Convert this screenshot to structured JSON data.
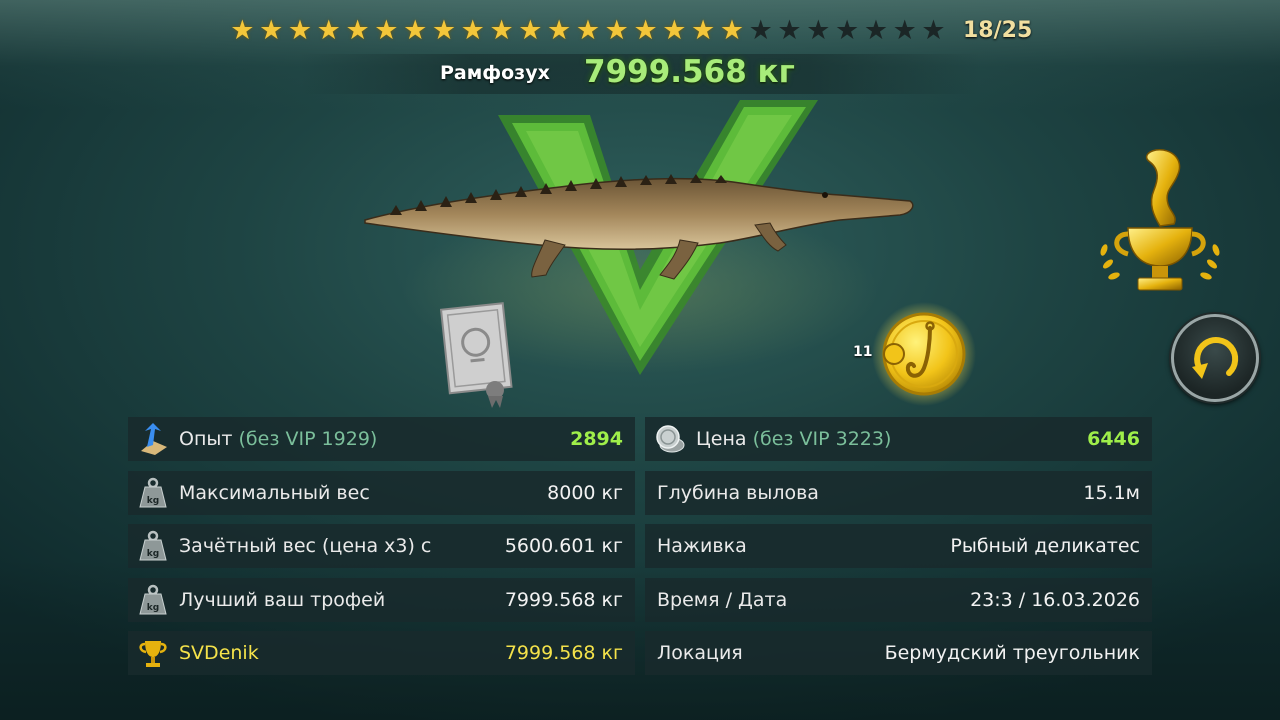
{
  "stars": {
    "filled": 18,
    "total": 25,
    "count_label": "18/25"
  },
  "catch": {
    "name": "Рамфозух",
    "weight": "7999.568 кг"
  },
  "coin": {
    "count": "11"
  },
  "icons": {
    "certificate": "certificate-icon",
    "coin": "hook-coin-icon",
    "trophy": "gold-trophy-icon",
    "repeat": "repeat-icon",
    "experience": "experience-arrow-icon",
    "price": "silver-coins-icon",
    "weight": "kg-weight-icon",
    "record": "trophy-cup-icon"
  },
  "colors": {
    "accent_green": "#9fef4a",
    "record_yellow": "#f4e24a",
    "star_gold": "#f3c63a"
  },
  "stats_left": [
    {
      "label": "Опыт",
      "sub": "(без VIP 1929)",
      "value": "2894"
    },
    {
      "label": "Максимальный вес",
      "value": "8000 кг"
    },
    {
      "label": "Зачётный вес (цена х3) с",
      "value": "5600.601 кг"
    },
    {
      "label": "Лучший ваш трофей",
      "value": "7999.568 кг"
    },
    {
      "label": "SVDenik",
      "value": "7999.568 кг"
    }
  ],
  "stats_right": [
    {
      "label": "Цена",
      "sub": "(без VIP 3223)",
      "value": "6446"
    },
    {
      "label": "Глубина вылова",
      "value": "15.1м"
    },
    {
      "label": "Наживка",
      "value": "Рыбный деликатес"
    },
    {
      "label": "Время / Дата",
      "value": "23:3 / 16.03.2026"
    },
    {
      "label": "Локация",
      "value": "Бермудский треугольник"
    }
  ]
}
